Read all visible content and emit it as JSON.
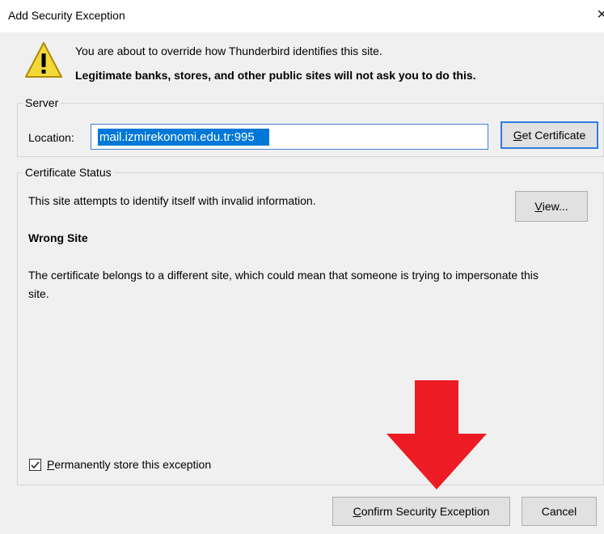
{
  "window": {
    "title": "Add Security Exception",
    "close_glyph": "✕"
  },
  "intro": {
    "line1": "You are about to override how Thunderbird identifies this site.",
    "line2": "Legitimate banks, stores, and other public sites will not ask you to do this.",
    "icon": "warning-icon"
  },
  "server": {
    "legend": "Server",
    "location_label": "Location:",
    "location_value": "mail.izmirekonomi.edu.tr:995",
    "get_cert_prefix": "G",
    "get_cert_rest": "et Certificate"
  },
  "status": {
    "legend": "Certificate Status",
    "summary": "This site attempts to identify itself with invalid information.",
    "view_prefix": "V",
    "view_rest": "iew...",
    "heading": "Wrong Site",
    "explanation": "The certificate belongs to a different site, which could mean that someone is trying to impersonate this site."
  },
  "options": {
    "permanent_prefix": "P",
    "permanent_rest": "ermanently store this exception",
    "permanent_checked": true
  },
  "actions": {
    "confirm_prefix": "C",
    "confirm_rest": "onfirm Security Exception",
    "cancel_label": "Cancel"
  },
  "colors": {
    "annotation_arrow": "#ed1c24",
    "selection": "#0078d7",
    "focus_border": "#2f7de1"
  }
}
